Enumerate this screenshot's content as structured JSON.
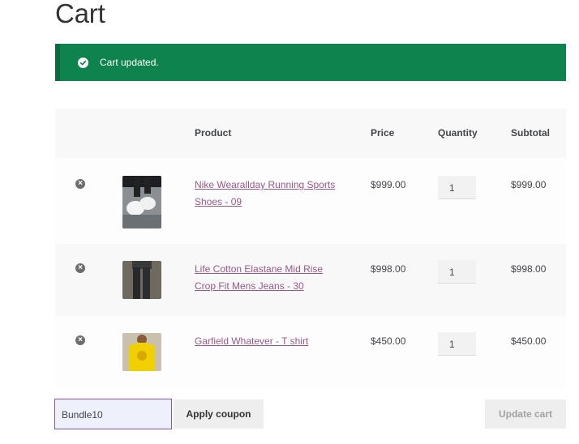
{
  "page": {
    "title": "Cart"
  },
  "notice": {
    "message": "Cart updated."
  },
  "table": {
    "headers": {
      "product": "Product",
      "price": "Price",
      "quantity": "Quantity",
      "subtotal": "Subtotal"
    },
    "rows": [
      {
        "name_line1": "Nike Wearallday Running Sports",
        "name_line2": "Shoes - 09",
        "price": "$999.00",
        "quantity": "1",
        "subtotal": "$999.00"
      },
      {
        "name_line1": "Life Cotton Elastane Mid Rise",
        "name_line2": "Crop Fit Mens Jeans - 30",
        "price": "$998.00",
        "quantity": "1",
        "subtotal": "$998.00"
      },
      {
        "name_line1": "Garfield Whatever - T shirt",
        "name_line2": "",
        "price": "$450.00",
        "quantity": "1",
        "subtotal": "$450.00"
      }
    ]
  },
  "actions": {
    "coupon_value": "Bundle10",
    "apply_label": "Apply coupon",
    "update_label": "Update cart"
  },
  "colors": {
    "notice_bg": "#0f834d",
    "link": "#96588a",
    "input_border": "#7f54b3"
  }
}
